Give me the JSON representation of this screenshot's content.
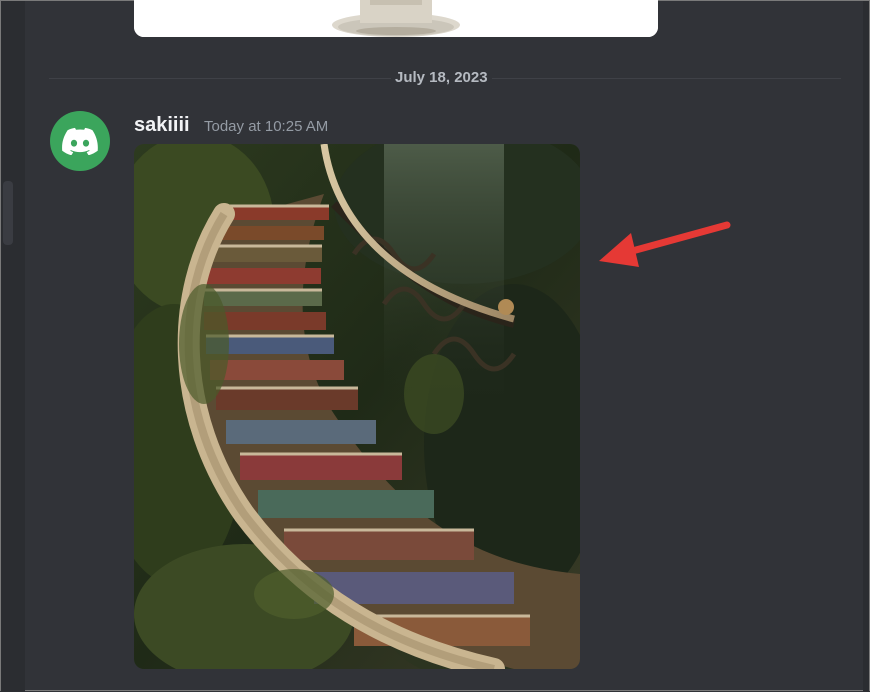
{
  "date_divider": {
    "label": "July 18, 2023"
  },
  "message": {
    "username": "sakiiii",
    "timestamp": "Today at 10:25 AM",
    "avatar_icon": "discord-logo-icon",
    "avatar_color": "#3ba55c"
  },
  "attachment": {
    "kind": "image"
  },
  "colors": {
    "background": "#313338",
    "arrow": "#e53935",
    "username": "#f2f3f5",
    "timestamp": "#949ba4"
  }
}
